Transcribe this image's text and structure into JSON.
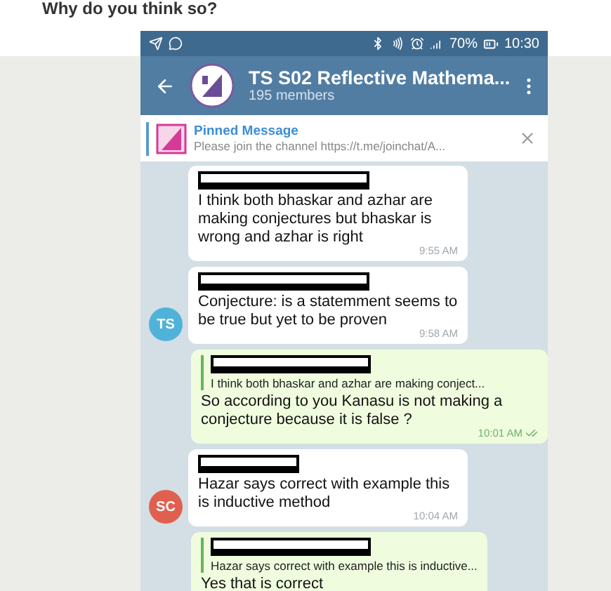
{
  "page_heading": "Why do you think so?",
  "status_bar": {
    "battery": "70%",
    "time": "10:30"
  },
  "chat": {
    "title": "TS S02 Reflective Mathema...",
    "subtitle": "195 members"
  },
  "pinned": {
    "label": "Pinned Message",
    "text": "Please join the channel https://t.me/joinchat/A..."
  },
  "messages": [
    {
      "kind": "incoming",
      "text": "I think both bhaskar and azhar are making conjectures but bhaskar is wrong and azhar is right",
      "time": "9:55 AM"
    },
    {
      "kind": "incoming",
      "avatar": {
        "initials": "TS",
        "color": "#4fb3d9"
      },
      "text": "Conjecture: is a statemment seems to be true but yet to be proven",
      "time": "9:58 AM"
    },
    {
      "kind": "outgoing",
      "reply": "I think both bhaskar and azhar are making conject...",
      "text": "So according to you Kanasu is not making a conjecture because it is false ?",
      "time": "10:01 AM",
      "read": true
    },
    {
      "kind": "incoming",
      "avatar": {
        "initials": "SC",
        "color": "#e0604f"
      },
      "text": "Hazar says correct with example this is inductive method",
      "time": "10:04 AM"
    },
    {
      "kind": "outgoing",
      "reply": "Hazar says correct with example this is inductive...",
      "text": "Yes that is correct"
    }
  ]
}
